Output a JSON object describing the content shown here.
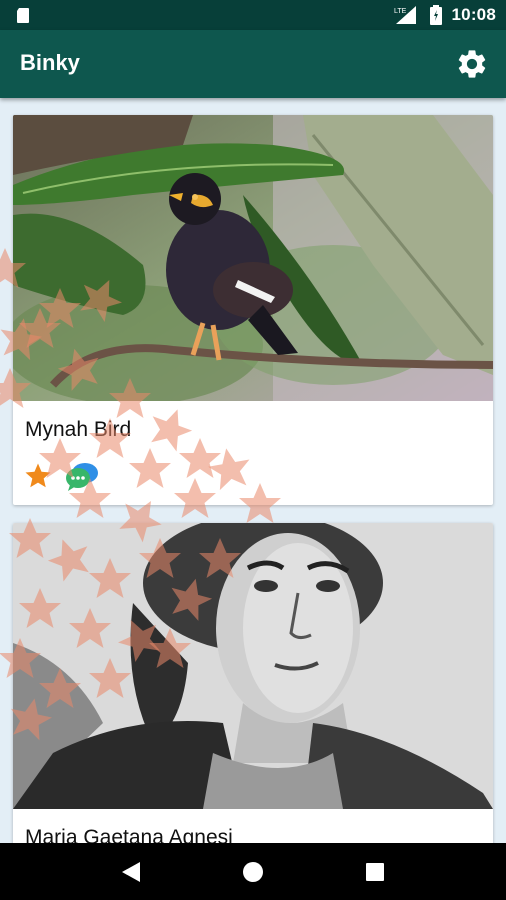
{
  "status_bar": {
    "time": "10:08",
    "network_label": "LTE",
    "icons": [
      "sd-card-icon",
      "signal-icon",
      "battery-icon"
    ]
  },
  "app_bar": {
    "title": "Binky",
    "settings_icon": "gear-icon"
  },
  "cards": [
    {
      "title": "Mynah Bird",
      "image": "mynah-bird-photo",
      "actions": [
        "star-icon",
        "chat-bubbles-icon"
      ]
    },
    {
      "title": "Maria Gaetana Agnesi",
      "image": "agnesi-portrait-engraving"
    }
  ],
  "nav_bar": {
    "buttons": [
      "back-icon",
      "home-icon",
      "recents-icon"
    ]
  },
  "colors": {
    "status_bar": "#073f39",
    "app_bar": "#0e574e",
    "background": "#e3eef6",
    "star": "#f08a1c",
    "confetti": "#e9896a"
  }
}
